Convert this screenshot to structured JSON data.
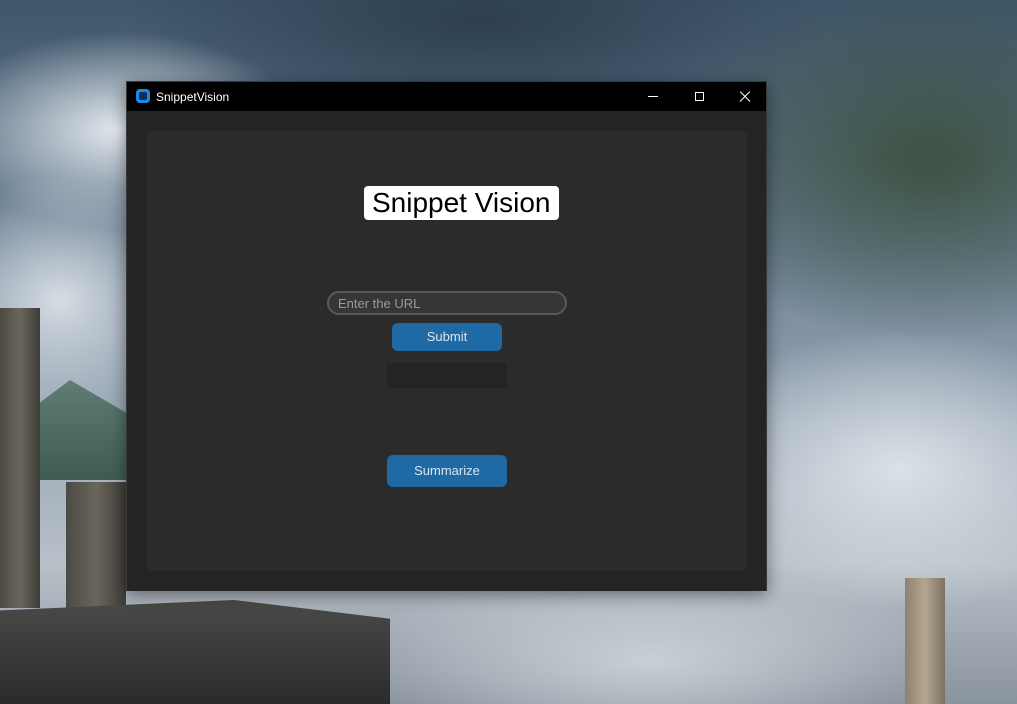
{
  "window": {
    "title": "SnippetVision",
    "controls": {
      "minimize_icon": "minimize-icon",
      "maximize_icon": "maximize-icon",
      "close_icon": "close-icon"
    }
  },
  "main": {
    "heading": "Snippet Vision",
    "url_input": {
      "value": "",
      "placeholder": "Enter the URL"
    },
    "submit_label": "Submit",
    "output_text": "",
    "summarize_label": "Summarize"
  },
  "colors": {
    "accent": "#1f6aa5",
    "window_bg": "#242424",
    "frame_bg": "#2b2b2b",
    "titlebar_bg": "#000000"
  }
}
